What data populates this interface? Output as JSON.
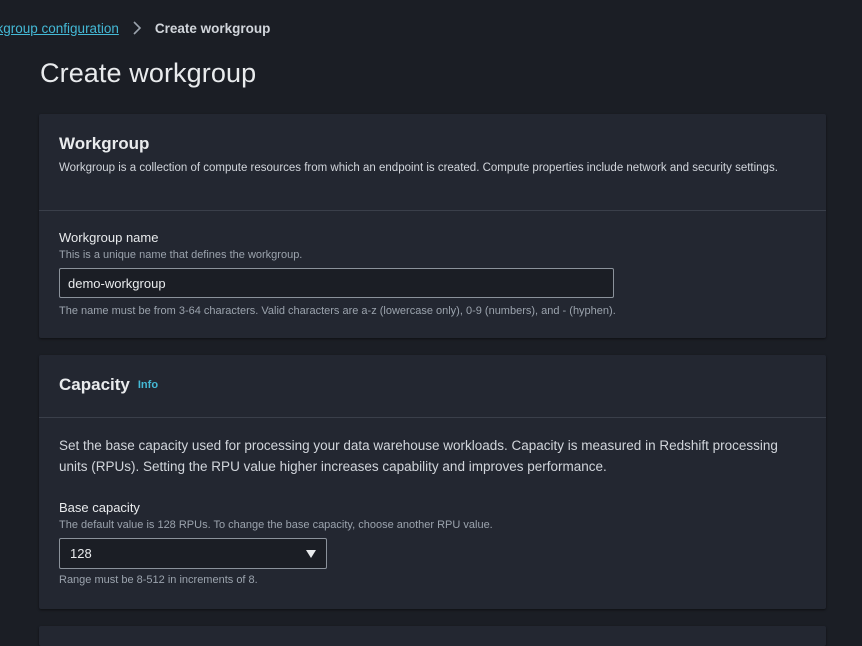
{
  "breadcrumb": {
    "parent_label": "Workgroup configuration",
    "current_label": "Create workgroup"
  },
  "page": {
    "title": "Create workgroup"
  },
  "workgroup_panel": {
    "title": "Workgroup",
    "description": "Workgroup is a collection of compute resources from which an endpoint is created. Compute properties include network and security settings.",
    "name_field": {
      "label": "Workgroup name",
      "hint": "This is a unique name that defines the workgroup.",
      "value": "demo-workgroup",
      "constraint": "The name must be from 3-64 characters. Valid characters are a-z (lowercase only), 0-9 (numbers), and - (hyphen)."
    }
  },
  "capacity_panel": {
    "title": "Capacity",
    "info_label": "Info",
    "description": "Set the base capacity used for processing your data warehouse workloads. Capacity is measured in Redshift processing units (RPUs). Setting the RPU value higher increases capability and improves performance.",
    "base_capacity": {
      "label": "Base capacity",
      "hint": "The default value is 128 RPUs. To change the base capacity, choose another RPU value.",
      "selected": "128",
      "constraint": "Range must be 8-512 in increments of 8."
    }
  },
  "colors": {
    "background": "#1b1e25",
    "panel": "#232731",
    "link": "#44b9d6",
    "text": "#d1d5db",
    "muted": "#9ba3ad"
  }
}
